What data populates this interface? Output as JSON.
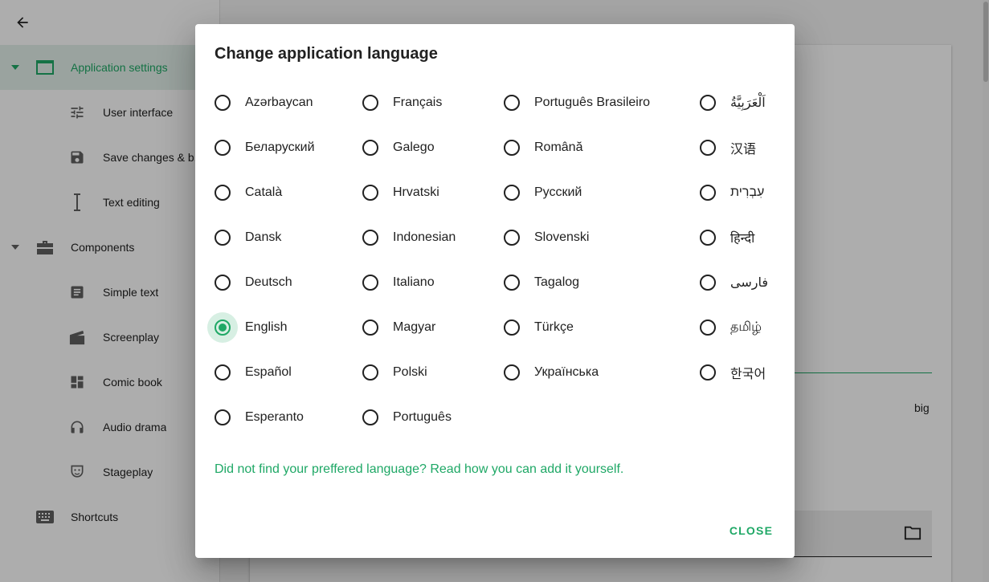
{
  "sidebar": {
    "items": [
      {
        "label": "Application settings",
        "icon": "window-icon"
      },
      {
        "label": "User interface",
        "icon": "sliders-icon"
      },
      {
        "label": "Save changes & b...",
        "icon": "floppy-disk-icon"
      },
      {
        "label": "Text editing",
        "icon": "text-cursor-icon"
      },
      {
        "label": "Components",
        "icon": "toolbox-icon"
      },
      {
        "label": "Simple text",
        "icon": "document-icon"
      },
      {
        "label": "Screenplay",
        "icon": "clapperboard-icon"
      },
      {
        "label": "Comic book",
        "icon": "dashboard-icon"
      },
      {
        "label": "Audio drama",
        "icon": "headphones-icon"
      },
      {
        "label": "Stageplay",
        "icon": "theater-mask-icon"
      },
      {
        "label": "Shortcuts",
        "icon": "keyboard-icon"
      }
    ]
  },
  "content": {
    "big_label": "big"
  },
  "dialog": {
    "title": "Change application language",
    "languages": [
      "Azərbaycan",
      "Беларуский",
      "Català",
      "Dansk",
      "Deutsch",
      "English",
      "Español",
      "Esperanto",
      "Français",
      "Galego",
      "Hrvatski",
      "Indonesian",
      "Italiano",
      "Magyar",
      "Polski",
      "Português",
      "Português Brasileiro",
      "Română",
      "Русский",
      "Slovenski",
      "Tagalog",
      "Türkçe",
      "Українська",
      "اَلْعَرَبِيَّةُ",
      "汉语",
      "עִבְרִית",
      "हिन्दी",
      "فارسی",
      "தமிழ்",
      "한국어"
    ],
    "selected": "English",
    "hint": "Did not find your preffered language? Read how you can add it yourself.",
    "close_label": "CLOSE"
  },
  "colors": {
    "accent": "#1fa866",
    "active_bg": "#e3f1ea",
    "scrim": "rgba(0,0,0,0.32)"
  }
}
